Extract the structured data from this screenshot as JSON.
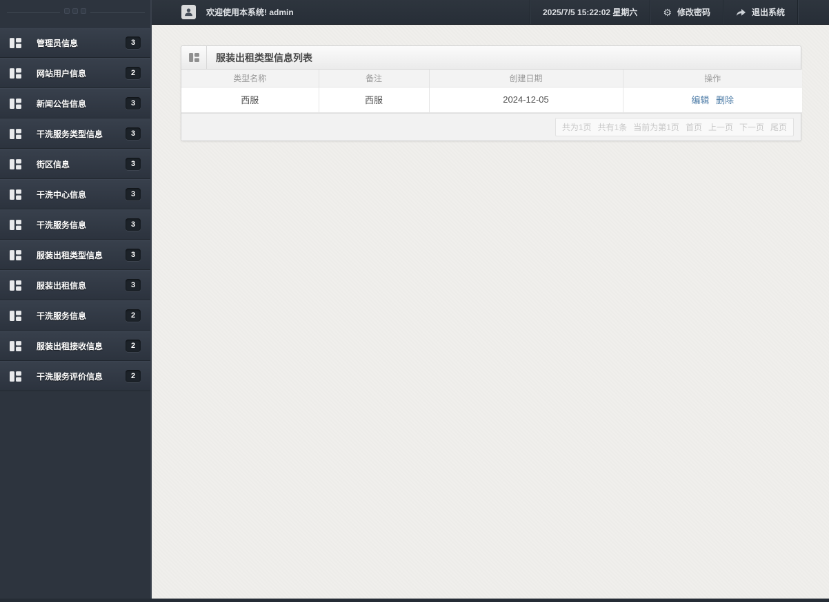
{
  "sidebar": {
    "items": [
      {
        "label": "管理员信息",
        "count": "3"
      },
      {
        "label": "网站用户信息",
        "count": "2"
      },
      {
        "label": "新闻公告信息",
        "count": "3"
      },
      {
        "label": "干洗服务类型信息",
        "count": "3"
      },
      {
        "label": "街区信息",
        "count": "3"
      },
      {
        "label": "干洗中心信息",
        "count": "3"
      },
      {
        "label": "干洗服务信息",
        "count": "3"
      },
      {
        "label": "服装出租类型信息",
        "count": "3"
      },
      {
        "label": "服装出租信息",
        "count": "3"
      },
      {
        "label": "干洗服务信息",
        "count": "2"
      },
      {
        "label": "服装出租接收信息",
        "count": "2"
      },
      {
        "label": "干洗服务评价信息",
        "count": "2"
      }
    ]
  },
  "header": {
    "welcome": "欢迎使用本系统! admin",
    "datetime": "2025/7/5 15:22:02 星期六",
    "change_password": "修改密码",
    "logout": "退出系统",
    "gear_glyph": "⚙"
  },
  "panel": {
    "title": "服装出租类型信息列表",
    "table": {
      "columns": [
        "类型名称",
        "备注",
        "创建日期",
        "操作"
      ],
      "rows": [
        {
          "cells": [
            "西服",
            "西服",
            "2024-12-05"
          ],
          "actions": [
            "编辑",
            "删除"
          ]
        }
      ]
    },
    "pagination": [
      "共为1页",
      "共有1条",
      "当前为第1页",
      "首页",
      "上一页",
      "下一页",
      "尾页"
    ]
  },
  "icons": {
    "sidebar_item": "grid-icon",
    "panel_header": "grid-icon",
    "avatar": "user-silhouette-icon",
    "change_password": "gear-icon",
    "logout": "forward-arrow-icon"
  },
  "colors": {
    "sidebar_bg": "#2d343e",
    "sidebar_item_gradient_top": "#38404c",
    "sidebar_item_gradient_bottom": "#2c333e",
    "badge_bg": "#1c2229",
    "header_bg": "#2b323b",
    "content_bg": "#f0efec",
    "panel_border": "#d2d2d2",
    "table_header_bg": "#f3f3f3",
    "muted_text": "#9a9a9a",
    "link": "#4d7ca7",
    "pagination_text": "#c8c8c8",
    "bottom_strip": "#252c35"
  }
}
